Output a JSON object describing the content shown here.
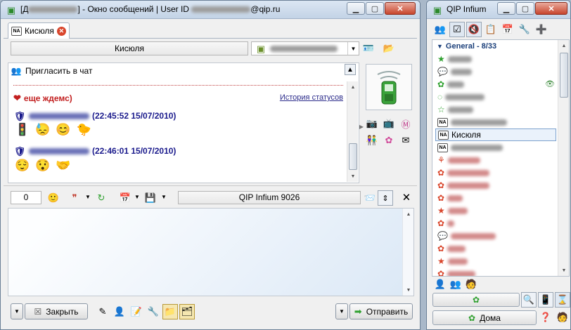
{
  "chat_window": {
    "title": "[Д] - Окно сообщений | User ID @qip.ru",
    "title_prefix": "[Д",
    "title_mid": "] - Окно сообщений | User ID ",
    "title_suffix": "@qip.ru",
    "tab_label": "Кисюля",
    "contact_name": "Кисюля",
    "invite_label": "Пригласить в чат",
    "status_text": "еще ждемс)",
    "history_link": "История статусов",
    "messages": [
      {
        "time": "(22:45:52 15/07/2010)",
        "smiles": [
          "🚦",
          "😓",
          "😊",
          "🐤"
        ]
      },
      {
        "time": "(22:46:01 15/07/2010)",
        "smiles": [
          "😌",
          "😯",
          "🤝"
        ]
      }
    ],
    "counter": "0",
    "client_version": "QIP Infium 9026",
    "close_label": "Закрыть",
    "send_label": "Отправить"
  },
  "qip_window": {
    "title": "QIP Infium",
    "group_label": "General - 8/33",
    "selected_contact": "Кисюля",
    "home_label": "Дома"
  },
  "colors": {
    "status_red": "#c21f1f",
    "name_blue": "#1a1a8c",
    "link_blue": "#2a2a8a",
    "group_blue": "#1b3f7a",
    "online_green": "#2fa02f",
    "offline_red": "#d9452b"
  }
}
